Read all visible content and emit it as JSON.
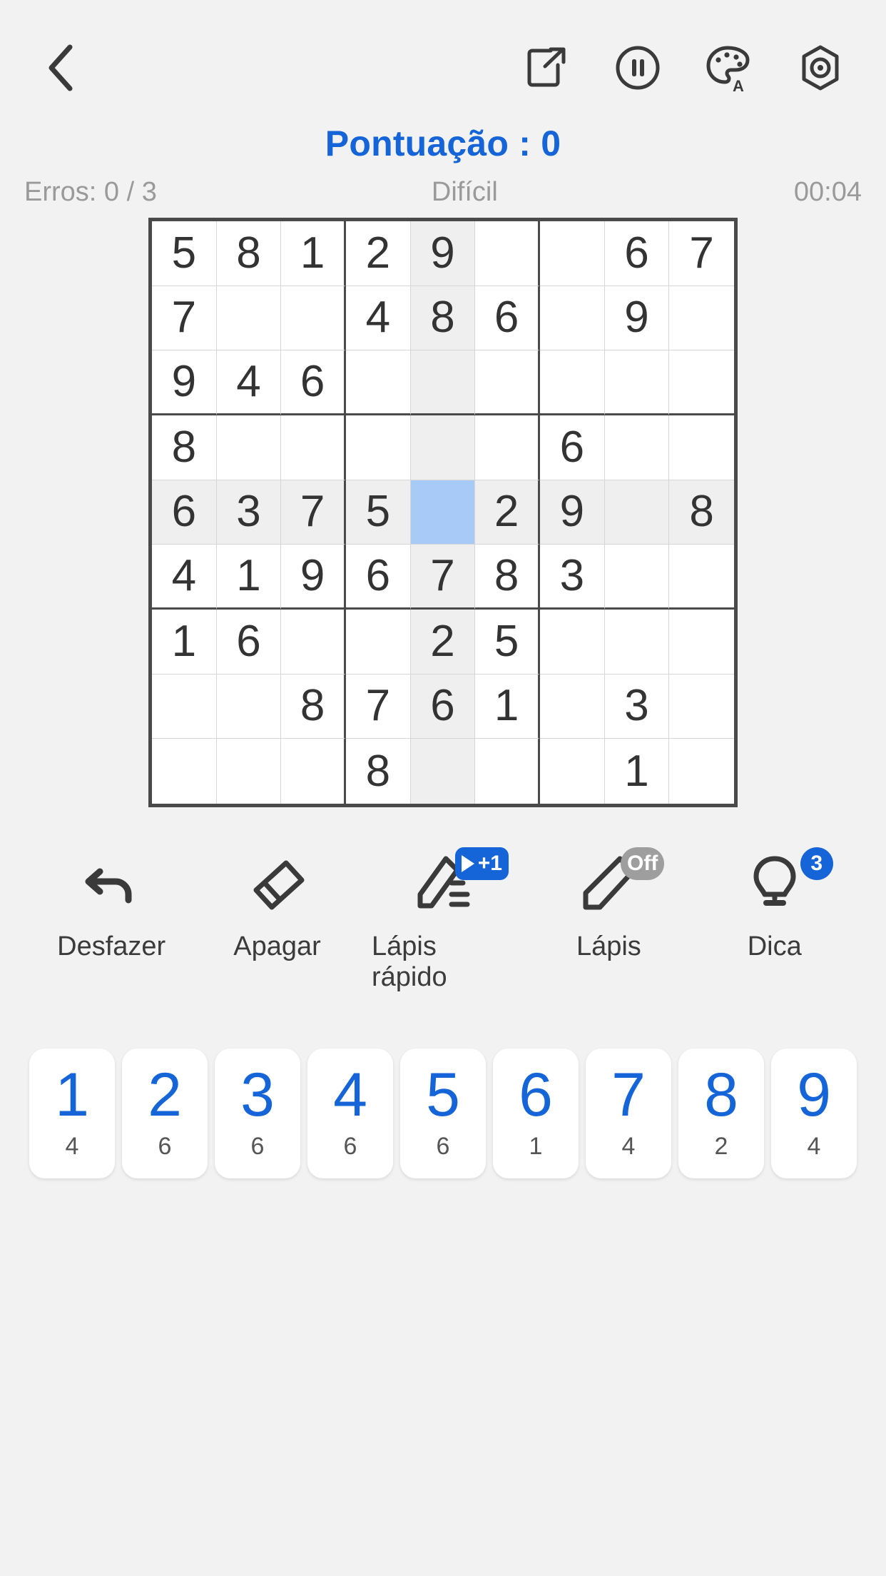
{
  "topbar": {
    "back_label": "back",
    "actions": [
      {
        "name": "share-icon",
        "label": "Compartilhar"
      },
      {
        "name": "pause-icon",
        "label": "Pausar"
      },
      {
        "name": "theme-icon",
        "label": "Tema"
      },
      {
        "name": "settings-icon",
        "label": "Configurações"
      }
    ]
  },
  "status": {
    "score": "Pontuação : 0",
    "errors": "Erros: 0 / 3",
    "difficulty": "Difícil",
    "timer": "00:04"
  },
  "colors": {
    "accent": "#1565d8",
    "selected_cell": "#a8caf7",
    "highlight_cell": "#efefef",
    "grid_line": "#4a4a4a",
    "cell_text": "#333333",
    "muted_text": "#9a9a9a"
  },
  "board": {
    "selected": {
      "row": 4,
      "col": 4
    },
    "highlight_row": 4,
    "highlight_col": 4,
    "rows": [
      [
        "5",
        "8",
        "1",
        "2",
        "9",
        "",
        "",
        "6",
        "7"
      ],
      [
        "7",
        "",
        "",
        "4",
        "8",
        "6",
        "",
        "9",
        ""
      ],
      [
        "9",
        "4",
        "6",
        "",
        "",
        "",
        "",
        "",
        ""
      ],
      [
        "8",
        "",
        "",
        "",
        "",
        "",
        "6",
        "",
        ""
      ],
      [
        "6",
        "3",
        "7",
        "5",
        "",
        "2",
        "9",
        "",
        "8"
      ],
      [
        "4",
        "1",
        "9",
        "6",
        "7",
        "8",
        "3",
        "",
        ""
      ],
      [
        "1",
        "6",
        "",
        "",
        "2",
        "5",
        "",
        "",
        ""
      ],
      [
        "",
        "",
        "8",
        "7",
        "6",
        "1",
        "",
        "3",
        ""
      ],
      [
        "",
        "",
        "",
        "8",
        "",
        "",
        "",
        "1",
        ""
      ]
    ]
  },
  "tools": [
    {
      "icon": "undo-icon",
      "label": "Desfazer",
      "badge": null
    },
    {
      "icon": "eraser-icon",
      "label": "Apagar",
      "badge": null
    },
    {
      "icon": "quick-pencil-icon",
      "label": "Lápis rápido",
      "badge": "+1",
      "badge_type": "video"
    },
    {
      "icon": "pencil-icon",
      "label": "Lápis",
      "badge": "Off",
      "badge_type": "off"
    },
    {
      "icon": "hint-bulb-icon",
      "label": "Dica",
      "badge": "3",
      "badge_type": "count"
    }
  ],
  "numpad": [
    {
      "digit": "1",
      "count": "4"
    },
    {
      "digit": "2",
      "count": "6"
    },
    {
      "digit": "3",
      "count": "6"
    },
    {
      "digit": "4",
      "count": "6"
    },
    {
      "digit": "5",
      "count": "6"
    },
    {
      "digit": "6",
      "count": "1"
    },
    {
      "digit": "7",
      "count": "4"
    },
    {
      "digit": "8",
      "count": "2"
    },
    {
      "digit": "9",
      "count": "4"
    }
  ]
}
